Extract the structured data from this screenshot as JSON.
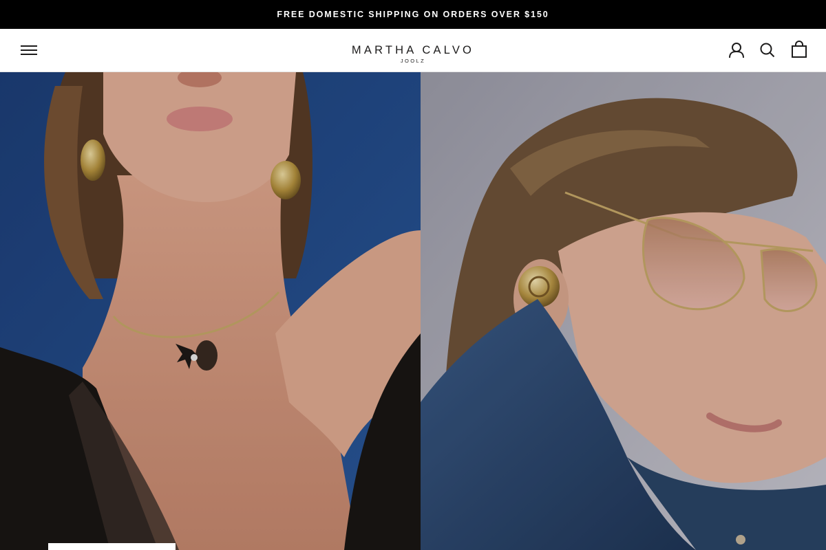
{
  "announcement": {
    "text": "FREE DOMESTIC SHIPPING ON ORDERS OVER $150"
  },
  "header": {
    "logo": {
      "name": "MARTHA CALVO",
      "tagline": "JOOLZ"
    },
    "icons": {
      "menu": "hamburger-menu-icon",
      "account": "account-icon",
      "search": "search-icon",
      "cart": "shopping-bag-icon"
    }
  },
  "hero": {
    "panels": [
      {
        "description_icon": "model-wearing-necklace-image",
        "background": "#1f4a86"
      },
      {
        "description_icon": "model-wearing-sunglasses-image",
        "background": "#a6a7b5"
      }
    ]
  },
  "colors": {
    "announcement_bg": "#000000",
    "announcement_text": "#ffffff",
    "header_bg": "#ffffff",
    "text": "#1c1b1b"
  }
}
